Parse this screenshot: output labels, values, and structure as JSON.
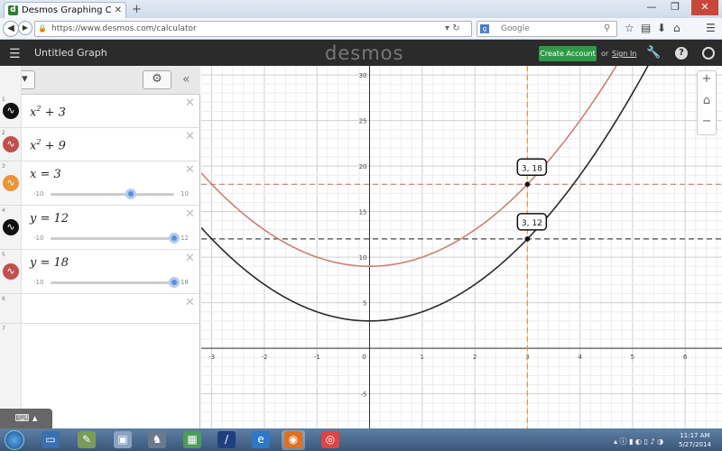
{
  "browser": {
    "tab_title": "Desmos Graphing Calculator",
    "tab_close": "✕",
    "new_tab": "+",
    "url": "https://www.desmos.com/calculator",
    "search_placeholder": "Google",
    "win_min": "—",
    "win_max": "❐",
    "win_close": "✕",
    "favicon_letter": "d"
  },
  "app": {
    "menu_glyph": "☰",
    "graph_title": "Untitled Graph",
    "logo": "desmos",
    "create_account": "Create Account",
    "or_text": "or",
    "sign_in": "Sign In"
  },
  "expressions": [
    {
      "num": "1",
      "color": "#111111",
      "base": "x",
      "exp": "2",
      "rest": " + 3"
    },
    {
      "num": "2",
      "color": "#c0504d",
      "base": "x",
      "exp": "2",
      "rest": " + 9"
    },
    {
      "num": "3",
      "color": "#e8953a",
      "text": "x = 3",
      "min": "-10",
      "max": "10",
      "value": 3
    },
    {
      "num": "4",
      "color": "#111111",
      "text": "y = 12",
      "min": "-10",
      "max": "12",
      "value": 12
    },
    {
      "num": "5",
      "color": "#c0504d",
      "text": "y = 18",
      "min": "-10",
      "max": "18",
      "value": 18
    },
    {
      "num": "6"
    },
    {
      "num": "7"
    }
  ],
  "graph": {
    "xrange": [
      -3.2,
      6.7
    ],
    "yrange": [
      -8.8,
      31
    ],
    "curves": [
      {
        "name": "x^2 + 3",
        "color": "#2a2a2a",
        "a": 1,
        "c": 3
      },
      {
        "name": "x^2 + 9",
        "color": "#c98078",
        "a": 1,
        "c": 9
      }
    ],
    "vline": {
      "x": 3,
      "color": "#e8953a"
    },
    "hlines": [
      {
        "y": 12,
        "color": "#111111"
      },
      {
        "y": 18,
        "color": "#c0504d"
      }
    ],
    "points": [
      {
        "x": 3,
        "y": 18,
        "label": "3, 18"
      },
      {
        "x": 3,
        "y": 12,
        "label": "3, 12"
      }
    ],
    "x_ticks": [
      "-3",
      "-2",
      "-1",
      "0",
      "1",
      "2",
      "3",
      "4",
      "5",
      "6"
    ],
    "y_ticks": [
      "30",
      "25",
      "20",
      "15",
      "10",
      "5",
      "-5"
    ]
  },
  "zoom": {
    "in": "+",
    "home": "⌂",
    "out": "−"
  },
  "taskbar": {
    "time": "11:17 AM",
    "date": "5/27/2014"
  }
}
